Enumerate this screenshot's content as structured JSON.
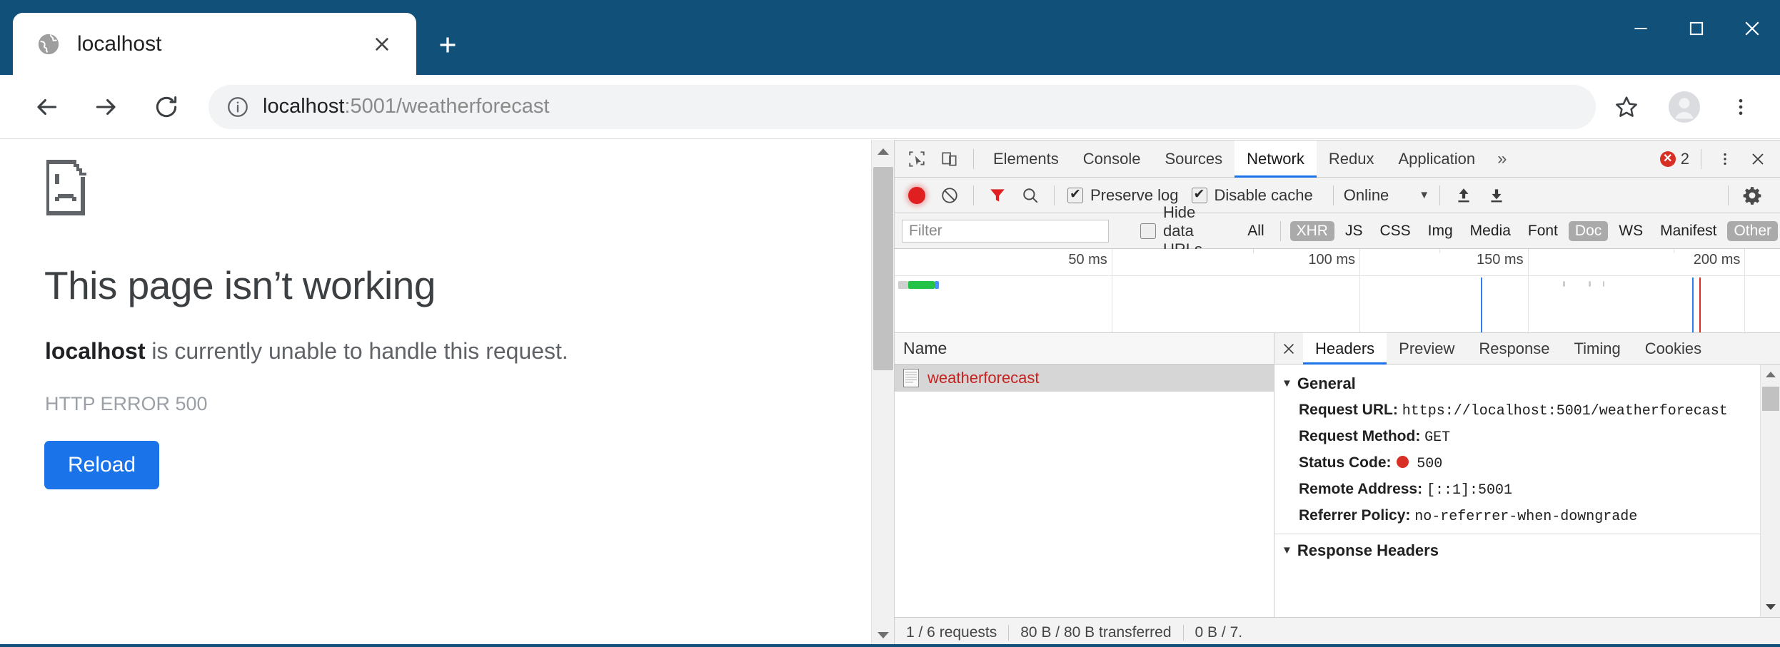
{
  "browser": {
    "tab": {
      "title": "localhost",
      "favicon_icon": "globe-icon",
      "close_icon": "close-icon"
    },
    "new_tab_icon": "plus-icon",
    "window_controls": {
      "minimize": "minimize-icon",
      "maximize": "maximize-icon",
      "close": "close-icon"
    },
    "nav": {
      "back_icon": "arrow-left-icon",
      "forward_icon": "arrow-right-icon",
      "reload_icon": "reload-icon",
      "security_icon": "info-circle-icon",
      "url_host": "localhost",
      "url_rest": ":5001/weatherforecast",
      "url_full": "localhost:5001/weatherforecast",
      "bookmark_icon": "star-icon",
      "profile_icon": "avatar-icon",
      "menu_icon": "more-vertical-icon"
    }
  },
  "error_page": {
    "icon": "sad-page-icon",
    "heading": "This page isn’t working",
    "message_host": "localhost",
    "message_rest": " is currently unable to handle this request.",
    "error_code": "HTTP ERROR 500",
    "reload_label": "Reload"
  },
  "devtools": {
    "left_icons": [
      {
        "name": "inspect-element-icon"
      },
      {
        "name": "device-toolbar-icon"
      }
    ],
    "tabs": [
      {
        "label": "Elements",
        "active": false
      },
      {
        "label": "Console",
        "active": false
      },
      {
        "label": "Sources",
        "active": false
      },
      {
        "label": "Network",
        "active": true
      },
      {
        "label": "Redux",
        "active": false
      },
      {
        "label": "Application",
        "active": false
      }
    ],
    "more_tabs_icon": "chevron-double-right-icon",
    "error_count": "2",
    "error_badge_glyph": "✕",
    "panel_menu_icon": "more-vertical-icon",
    "panel_close_icon": "close-icon",
    "toolbar": {
      "record_icon": "record-icon",
      "clear_icon": "clear-icon",
      "filter_icon": "funnel-icon",
      "search_icon": "search-icon",
      "preserve_log_label": "Preserve log",
      "preserve_log_checked": true,
      "disable_cache_label": "Disable cache",
      "disable_cache_checked": true,
      "throttling_value": "Online",
      "throttling_caret": "▼",
      "import_har_icon": "upload-icon",
      "export_har_icon": "download-icon",
      "settings_icon": "gear-icon"
    },
    "filterbar": {
      "filter_placeholder": "Filter",
      "filter_value": "",
      "hide_data_urls_label": "Hide data URLs",
      "hide_data_urls_checked": false,
      "types": [
        {
          "label": "All",
          "selected": false
        },
        {
          "label": "XHR",
          "selected": true
        },
        {
          "label": "JS",
          "selected": false
        },
        {
          "label": "CSS",
          "selected": false
        },
        {
          "label": "Img",
          "selected": false
        },
        {
          "label": "Media",
          "selected": false
        },
        {
          "label": "Font",
          "selected": false
        },
        {
          "label": "Doc",
          "selected": true
        },
        {
          "label": "WS",
          "selected": false
        },
        {
          "label": "Manifest",
          "selected": false
        },
        {
          "label": "Other",
          "selected": true
        }
      ]
    },
    "overview": {
      "ticks": [
        "50 ms",
        "100 ms",
        "150 ms",
        "200 ms"
      ],
      "tick_positions_pct": [
        24.5,
        52.5,
        71.5,
        96.0
      ],
      "bars": [
        {
          "color": "#cfcfcf",
          "left_pct": 0.4,
          "width_pct": 1.0
        },
        {
          "color": "#25c248",
          "left_pct": 1.4,
          "width_pct": 3.0
        },
        {
          "color": "#4d8ef7",
          "left_pct": 4.4,
          "width_pct": 0.5
        }
      ],
      "markers": [
        {
          "color": "#2f7ff0",
          "left_pct": 66.2
        },
        {
          "color": "#2f7ff0",
          "left_pct": 90.1
        },
        {
          "color": "#d93025",
          "left_pct": 90.9
        }
      ]
    },
    "request_table": {
      "column_header": "Name",
      "rows": [
        {
          "icon": "document-icon",
          "name": "weatherforecast",
          "selected": true,
          "error": true
        }
      ]
    },
    "details": {
      "close_icon": "close-icon",
      "tabs": [
        {
          "label": "Headers",
          "active": true
        },
        {
          "label": "Preview",
          "active": false
        },
        {
          "label": "Response",
          "active": false
        },
        {
          "label": "Timing",
          "active": false
        },
        {
          "label": "Cookies",
          "active": false
        }
      ],
      "general_section": {
        "title": "General",
        "expanded_caret": "▼",
        "fields": [
          {
            "key": "Request URL:",
            "value": "https://localhost:5001/weatherforecast"
          },
          {
            "key": "Request Method:",
            "value": "GET"
          },
          {
            "key": "Status Code:",
            "value": "500",
            "status_dot": true
          },
          {
            "key": "Remote Address:",
            "value": "[::1]:5001"
          },
          {
            "key": "Referrer Policy:",
            "value": "no-referrer-when-downgrade"
          }
        ]
      },
      "response_headers_section": {
        "title": "Response Headers",
        "expanded_caret": "▼"
      }
    },
    "status_bar": {
      "requests": "1 / 6 requests",
      "transferred": "80 B / 80 B transferred",
      "resources": "0 B / 7."
    }
  },
  "colors": {
    "title_bar": "#115179",
    "accent_blue": "#1a73e8",
    "error_red": "#d93025",
    "request_red": "#c5221f",
    "devtools_chrome": "#f3f3f3"
  }
}
